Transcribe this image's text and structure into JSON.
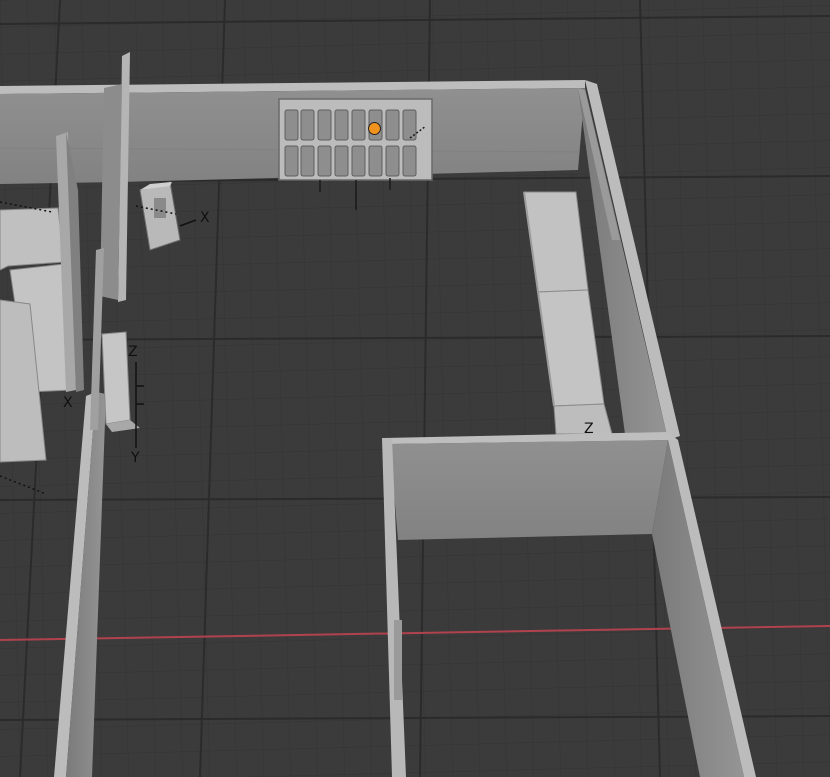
{
  "app": "3D viewport",
  "axis_labels": {
    "cabinet_x": "X",
    "locker_z": "Z",
    "locker_x": "X",
    "locker_y": "Y",
    "bench_z": "Z"
  },
  "colors": {
    "background": "#3b3b3b",
    "grid_line": "#2e2e2e",
    "x_axis_line": "#b0424e",
    "wall_top": "#b4b4b4",
    "wall_face": "#8c8c8c",
    "selection_origin": "#f0921e"
  },
  "icons": {
    "selected_object_origin": "origin-dot-icon"
  }
}
